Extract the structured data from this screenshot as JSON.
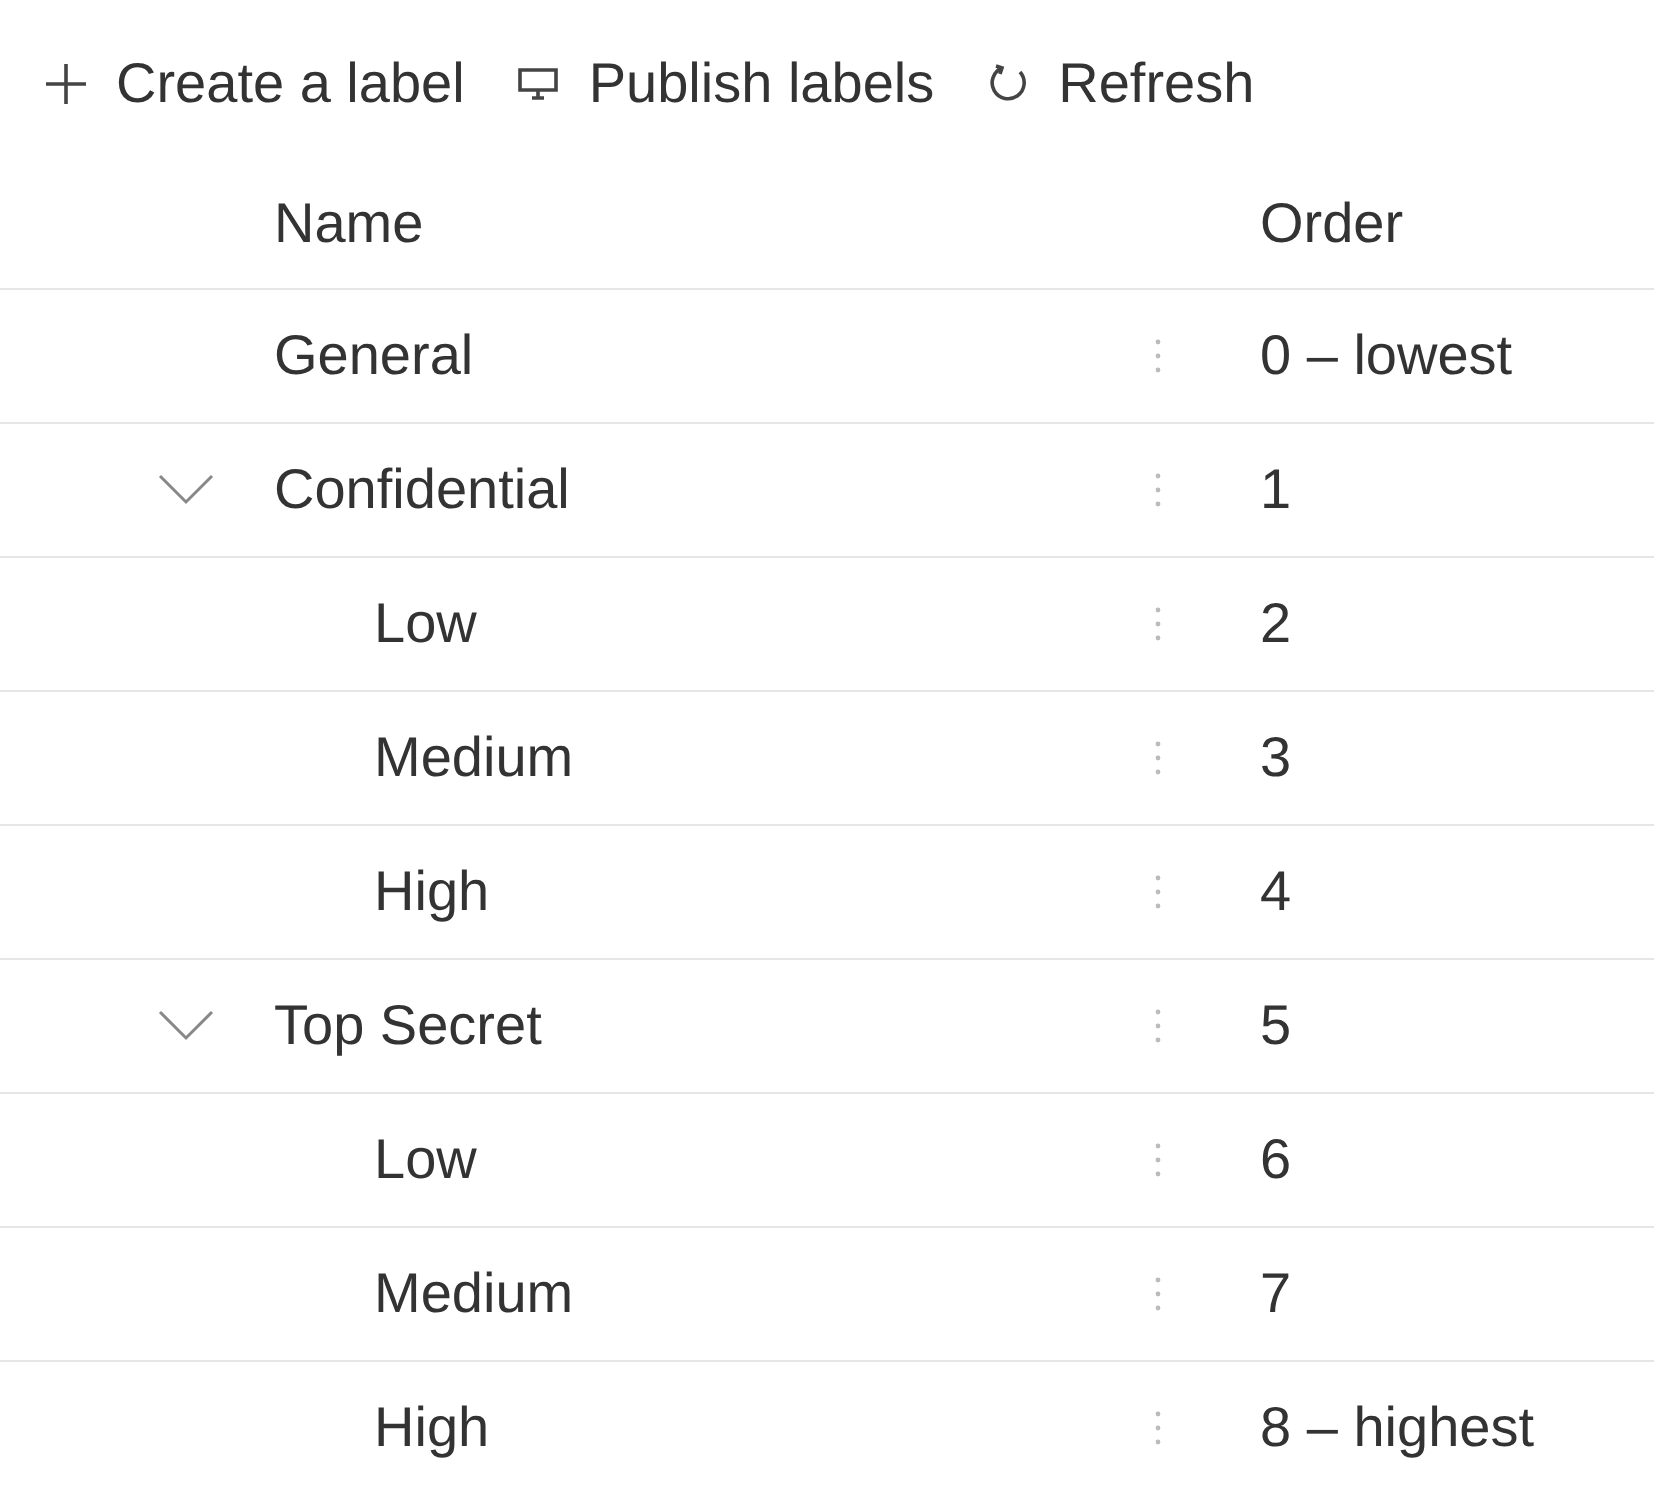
{
  "toolbar": [
    {
      "kind": "add",
      "label": "Create a label"
    },
    {
      "kind": "publish",
      "label": "Publish labels"
    },
    {
      "kind": "refresh",
      "label": "Refresh"
    }
  ],
  "columns": [
    "Name",
    "Order"
  ],
  "rows": [
    {
      "name": "General",
      "order": "0 – lowest"
    },
    {
      "name": "Confidential",
      "order": "1",
      "expanded": true,
      "children": [
        {
          "name": "Low",
          "order": "2"
        },
        {
          "name": "Medium",
          "order": "3"
        },
        {
          "name": "High",
          "order": "4"
        }
      ]
    },
    {
      "name": "Top Secret",
      "order": "5",
      "expanded": true,
      "children": [
        {
          "name": "Low",
          "order": "6"
        },
        {
          "name": "Medium",
          "order": "7"
        },
        {
          "name": "High",
          "order": "8 – highest"
        }
      ]
    }
  ]
}
